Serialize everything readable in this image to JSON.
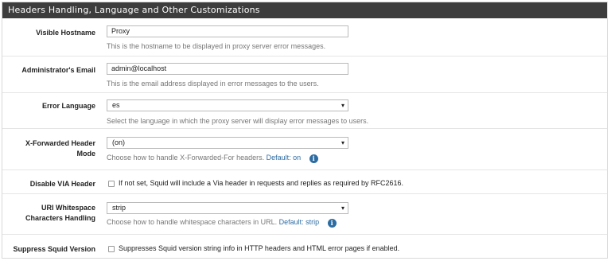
{
  "panel": {
    "title": "Headers Handling, Language and Other Customizations"
  },
  "rows": {
    "visible_hostname": {
      "label": "Visible Hostname",
      "value": "Proxy",
      "help": "This is the hostname to be displayed in proxy server error messages."
    },
    "admin_email": {
      "label": "Administrator's Email",
      "value": "admin@localhost",
      "help": "This is the email address displayed in error messages to the users."
    },
    "error_language": {
      "label": "Error Language",
      "value": "es",
      "help": "Select the language in which the proxy server will display error messages to users."
    },
    "x_forwarded": {
      "label_line1": "X-Forwarded Header",
      "label_line2": "Mode",
      "value": "(on)",
      "help": "Choose how to handle X-Forwarded-For headers.",
      "default": "Default: on"
    },
    "disable_via": {
      "label": "Disable VIA Header",
      "checked": false,
      "text": "If not set, Squid will include a Via header in requests and replies as required by RFC2616."
    },
    "uri_whitespace": {
      "label_line1": "URI Whitespace",
      "label_line2": "Characters Handling",
      "value": "strip",
      "help": "Choose how to handle whitespace characters in URL.",
      "default": "Default: strip"
    },
    "suppress_version": {
      "label": "Suppress Squid Version",
      "checked": false,
      "text": "Suppresses Squid version string info in HTTP headers and HTML error pages if enabled."
    }
  },
  "icons": {
    "dropdown": "chevron-down-icon",
    "info": "info-icon",
    "arrow_glyph": "▾",
    "info_glyph": "i"
  }
}
